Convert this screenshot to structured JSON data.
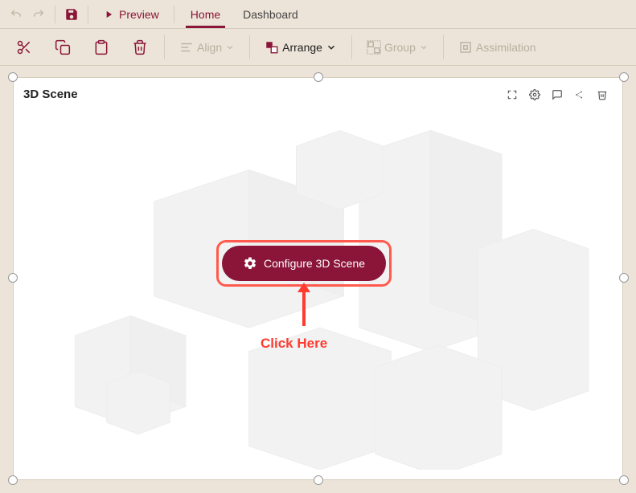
{
  "colors": {
    "accent": "#8a1538",
    "annotation": "#ff3b2f"
  },
  "topbar": {
    "preview_label": "Preview",
    "tabs": [
      {
        "label": "Home",
        "active": true
      },
      {
        "label": "Dashboard",
        "active": false
      }
    ]
  },
  "toolbar": {
    "align_label": "Align",
    "arrange_label": "Arrange",
    "group_label": "Group",
    "assimilation_label": "Assimilation"
  },
  "panel": {
    "title": "3D Scene",
    "configure_label": "Configure 3D Scene"
  },
  "annotation": {
    "click_here": "Click Here"
  }
}
